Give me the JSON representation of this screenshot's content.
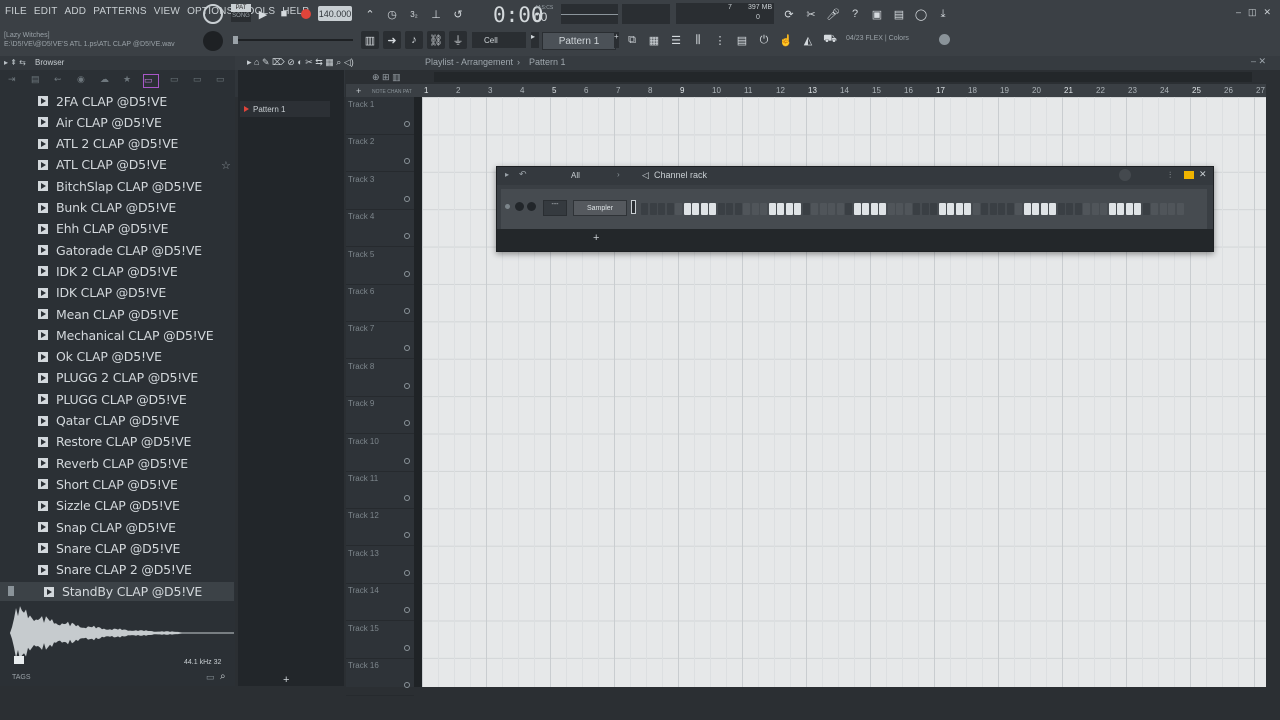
{
  "menu": [
    "FILE",
    "EDIT",
    "ADD",
    "PATTERNS",
    "VIEW",
    "OPTIONS",
    "TOOLS",
    "HELP"
  ],
  "transport": {
    "pat": "PAT",
    "song": "SONG",
    "tempo": "140.000",
    "time": "0:00",
    "time_sub": "00",
    "time_unit": "M:S:CS"
  },
  "hint": {
    "line1": "[Lazy Witches]",
    "line2": "E:\\D5!VE\\@D5!VE'S ATL 1.ps\\ATL CLAP @D5!VE.wav"
  },
  "status": {
    "cpu": "7",
    "mem": "397 MB",
    "voices": "0"
  },
  "toolbar": {
    "snap": "Cell",
    "pattern": "Pattern 1",
    "news": "04/23  FLEX | Colors"
  },
  "browser": {
    "title": "Browser",
    "items": [
      "2FA CLAP @D5!VE",
      "Air CLAP @D5!VE",
      "ATL 2 CLAP @D5!VE",
      "ATL CLAP @D5!VE",
      "BitchSlap CLAP @D5!VE",
      "Bunk CLAP @D5!VE",
      "Ehh CLAP @D5!VE",
      "Gatorade CLAP @D5!VE",
      "IDK 2 CLAP @D5!VE",
      "IDK CLAP @D5!VE",
      "Mean CLAP @D5!VE",
      "Mechanical CLAP @D5!VE",
      "Ok CLAP @D5!VE",
      "PLUGG 2 CLAP @D5!VE",
      "PLUGG CLAP @D5!VE",
      "Qatar CLAP @D5!VE",
      "Restore CLAP @D5!VE",
      "Reverb CLAP @D5!VE",
      "Short CLAP @D5!VE",
      "Sizzle CLAP @D5!VE",
      "Snap CLAP @D5!VE",
      "Snare CLAP @D5!VE",
      "Snare CLAP 2 @D5!VE"
    ],
    "selected": "StandBy CLAP @D5!VE",
    "sample_info": "44.1 kHz 32",
    "tags": "TAGS"
  },
  "picker": {
    "pattern": "Pattern 1"
  },
  "playlist": {
    "title": "Playlist - Arrangement",
    "pattern": "Pattern 1",
    "tracks": [
      "Track 1",
      "Track 2",
      "Track 3",
      "Track 4",
      "Track 5",
      "Track 6",
      "Track 7",
      "Track 8",
      "Track 9",
      "Track 10",
      "Track 11",
      "Track 12",
      "Track 13",
      "Track 14",
      "Track 15",
      "Track 16"
    ],
    "bars": [
      "1",
      "2",
      "3",
      "4",
      "5",
      "6",
      "7",
      "8",
      "9",
      "10",
      "11",
      "12",
      "13",
      "14",
      "15",
      "16",
      "17",
      "18",
      "19",
      "20",
      "21",
      "22",
      "23",
      "24",
      "25",
      "26",
      "27"
    ]
  },
  "rack": {
    "title": "Channel rack",
    "filter": "All",
    "channel": "Sampler",
    "steps": [
      0,
      0,
      0,
      0,
      0,
      1,
      1,
      1,
      1,
      0,
      0,
      0,
      0,
      0,
      0,
      1,
      1,
      1,
      1,
      0,
      0,
      0,
      0,
      0,
      0,
      1,
      1,
      1,
      1,
      0,
      0,
      0,
      0,
      0,
      0,
      1,
      1,
      1,
      1,
      0,
      0,
      0,
      0,
      0,
      0,
      1,
      1,
      1,
      1,
      0,
      0,
      0,
      0,
      0,
      0,
      1,
      1,
      1,
      1,
      0,
      0,
      0,
      0,
      0
    ]
  }
}
